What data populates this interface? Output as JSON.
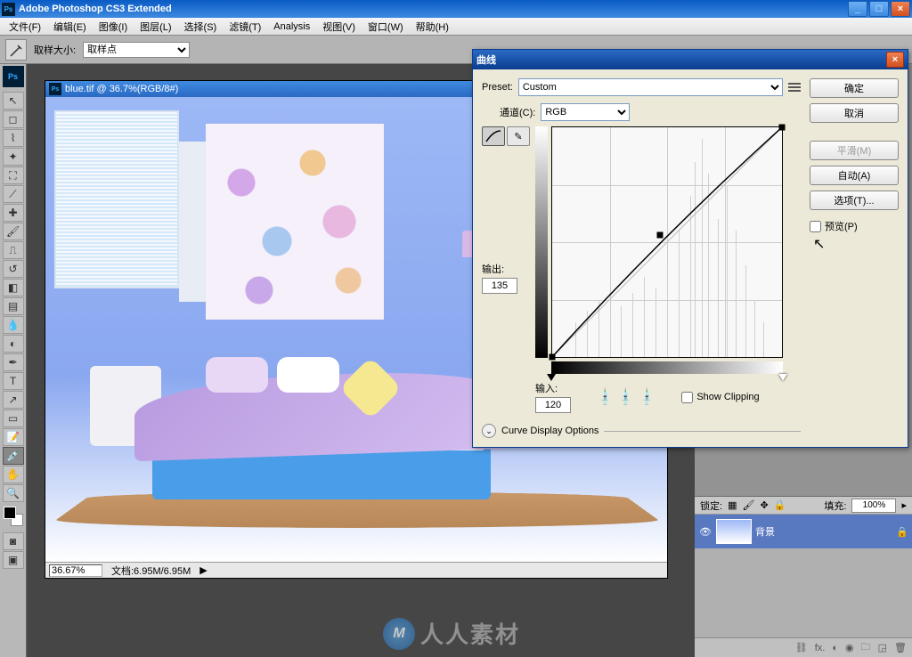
{
  "app": {
    "title": "Adobe Photoshop CS3 Extended",
    "logo": "Ps"
  },
  "menu": {
    "file": "文件(F)",
    "edit": "编辑(E)",
    "image": "图像(I)",
    "layer": "图层(L)",
    "select": "选择(S)",
    "filter": "滤镜(T)",
    "analysis": "Analysis",
    "view": "视图(V)",
    "window": "窗口(W)",
    "help": "帮助(H)"
  },
  "options": {
    "sample_label": "取样大小:",
    "sample_value": "取样点"
  },
  "document": {
    "title": "blue.tif @ 36.7%(RGB/8#)",
    "zoom": "36.67%",
    "docinfo": "文档:6.95M/6.95M"
  },
  "curves": {
    "title": "曲线",
    "preset_label": "Preset:",
    "preset_value": "Custom",
    "channel_label": "通道(C):",
    "channel_value": "RGB",
    "output_label": "输出:",
    "output_value": "135",
    "input_label": "输入:",
    "input_value": "120",
    "show_clipping": "Show Clipping",
    "curve_display": "Curve Display Options",
    "btn_ok": "确定",
    "btn_cancel": "取消",
    "btn_smooth": "平滑(M)",
    "btn_auto": "自动(A)",
    "btn_options": "选项(T)...",
    "preview": "预览(P)"
  },
  "layers": {
    "lock": "锁定:",
    "fill": "填充:",
    "fill_value": "100%",
    "layer_name": "背景"
  },
  "watermark": "人人素材",
  "chart_data": {
    "type": "line",
    "title": "Curves",
    "xlabel": "Input",
    "ylabel": "Output",
    "xlim": [
      0,
      255
    ],
    "ylim": [
      0,
      255
    ],
    "points": [
      {
        "x": 0,
        "y": 0
      },
      {
        "x": 120,
        "y": 135
      },
      {
        "x": 255,
        "y": 255
      }
    ]
  }
}
